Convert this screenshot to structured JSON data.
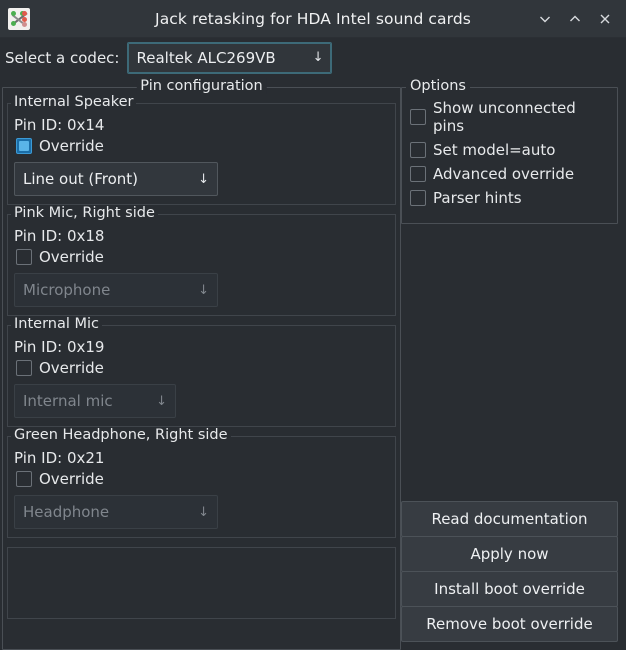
{
  "window": {
    "title": "Jack retasking for HDA Intel sound cards",
    "icon": "jack-retasking-icon",
    "controls": {
      "minimize": "chevron-down-icon",
      "maximize": "chevron-up-icon",
      "close": "close-icon"
    }
  },
  "codec": {
    "label": "Select a codec:",
    "selected": "Realtek ALC269VB",
    "arrow": "↓"
  },
  "pin_configuration": {
    "title": "Pin configuration",
    "override_label": "Override",
    "pin_id_prefix": "Pin ID: ",
    "groups": [
      {
        "title": "Internal Speaker",
        "pin_id": "Pin ID: 0x14",
        "override_label": "Override",
        "override_checked": true,
        "combo_value": "Line out (Front)",
        "combo_enabled": true,
        "arrow": "↓"
      },
      {
        "title": "Pink Mic, Right side",
        "pin_id": "Pin ID: 0x18",
        "override_label": "Override",
        "override_checked": false,
        "combo_value": "Microphone",
        "combo_enabled": false,
        "arrow": "↓"
      },
      {
        "title": "Internal Mic",
        "pin_id": "Pin ID: 0x19",
        "override_label": "Override",
        "override_checked": false,
        "combo_value": "Internal mic",
        "combo_enabled": false,
        "arrow": "↓"
      },
      {
        "title": "Green Headphone, Right side",
        "pin_id": "Pin ID: 0x21",
        "override_label": "Override",
        "override_checked": false,
        "combo_value": "Headphone",
        "combo_enabled": false,
        "arrow": "↓"
      }
    ]
  },
  "options": {
    "title": "Options",
    "items": [
      {
        "label": "Show unconnected pins",
        "checked": false
      },
      {
        "label": "Set model=auto",
        "checked": false
      },
      {
        "label": "Advanced override",
        "checked": false
      },
      {
        "label": "Parser hints",
        "checked": false
      }
    ]
  },
  "buttons": [
    {
      "label": "Read documentation"
    },
    {
      "label": "Apply now"
    },
    {
      "label": "Install boot override"
    },
    {
      "label": "Remove boot override"
    }
  ],
  "colors": {
    "window_bg": "#292d32",
    "titlebar_bg": "#31363b",
    "accent_focus": "#3d6a78",
    "checkbox_checked": "#5ab4e8",
    "text": "#e8eaec",
    "text_disabled": "#80868d",
    "border": "#4a4f55",
    "button_bg": "#373c42"
  }
}
